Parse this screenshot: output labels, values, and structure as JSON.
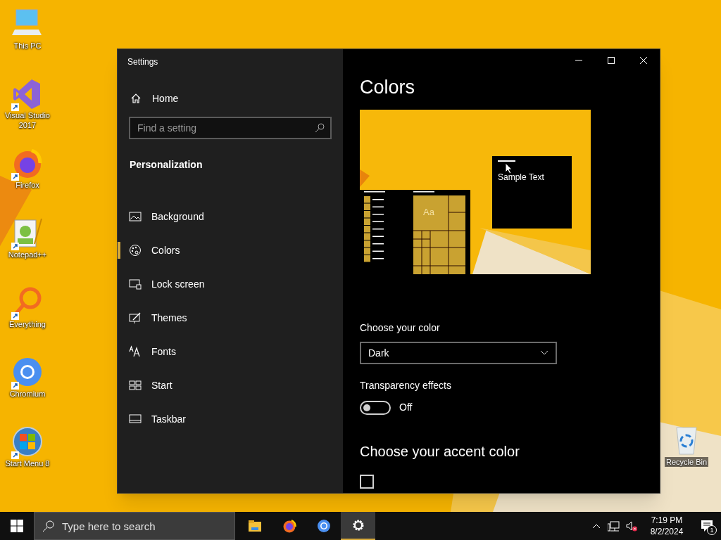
{
  "desktop_icons": [
    {
      "label": "This PC",
      "kind": "pc",
      "shortcut": false
    },
    {
      "label": "Visual Studio 2017",
      "kind": "vs",
      "shortcut": true
    },
    {
      "label": "Firefox",
      "kind": "firefox",
      "shortcut": true
    },
    {
      "label": "Notepad++",
      "kind": "notepad",
      "shortcut": true
    },
    {
      "label": "Everything",
      "kind": "everything",
      "shortcut": true
    },
    {
      "label": "Chromium",
      "kind": "chromium",
      "shortcut": true
    },
    {
      "label": "Start Menu 8",
      "kind": "startmenu",
      "shortcut": true
    }
  ],
  "recycle_bin": {
    "label": "Recycle Bin"
  },
  "window": {
    "title": "Settings",
    "sidebar": {
      "home": "Home",
      "search": {
        "placeholder": "Find a setting"
      },
      "section": "Personalization",
      "items": [
        {
          "label": "Background",
          "kind": "background",
          "selected": false
        },
        {
          "label": "Colors",
          "kind": "colors",
          "selected": true
        },
        {
          "label": "Lock screen",
          "kind": "lock",
          "selected": false
        },
        {
          "label": "Themes",
          "kind": "themes",
          "selected": false
        },
        {
          "label": "Fonts",
          "kind": "fonts",
          "selected": false
        },
        {
          "label": "Start",
          "kind": "start",
          "selected": false
        },
        {
          "label": "Taskbar",
          "kind": "taskbar",
          "selected": false
        }
      ]
    },
    "content": {
      "title": "Colors",
      "preview": {
        "sample_text": "Sample Text",
        "tile_text": "Aa"
      },
      "choose_color": {
        "label": "Choose your color",
        "value": "Dark"
      },
      "transparency": {
        "label": "Transparency effects",
        "on": false,
        "state_text": "Off"
      },
      "accent_heading": "Choose your accent color",
      "auto_accent": {
        "checked": false
      }
    }
  },
  "taskbar": {
    "search": {
      "placeholder": "Type here to search"
    },
    "apps": [
      {
        "kind": "explorer",
        "selected": false
      },
      {
        "kind": "firefox",
        "selected": false
      },
      {
        "kind": "chromium",
        "selected": false
      },
      {
        "kind": "settings",
        "selected": true
      }
    ],
    "time": "7:19 PM",
    "date": "8/2/2024",
    "notifications": "1"
  }
}
